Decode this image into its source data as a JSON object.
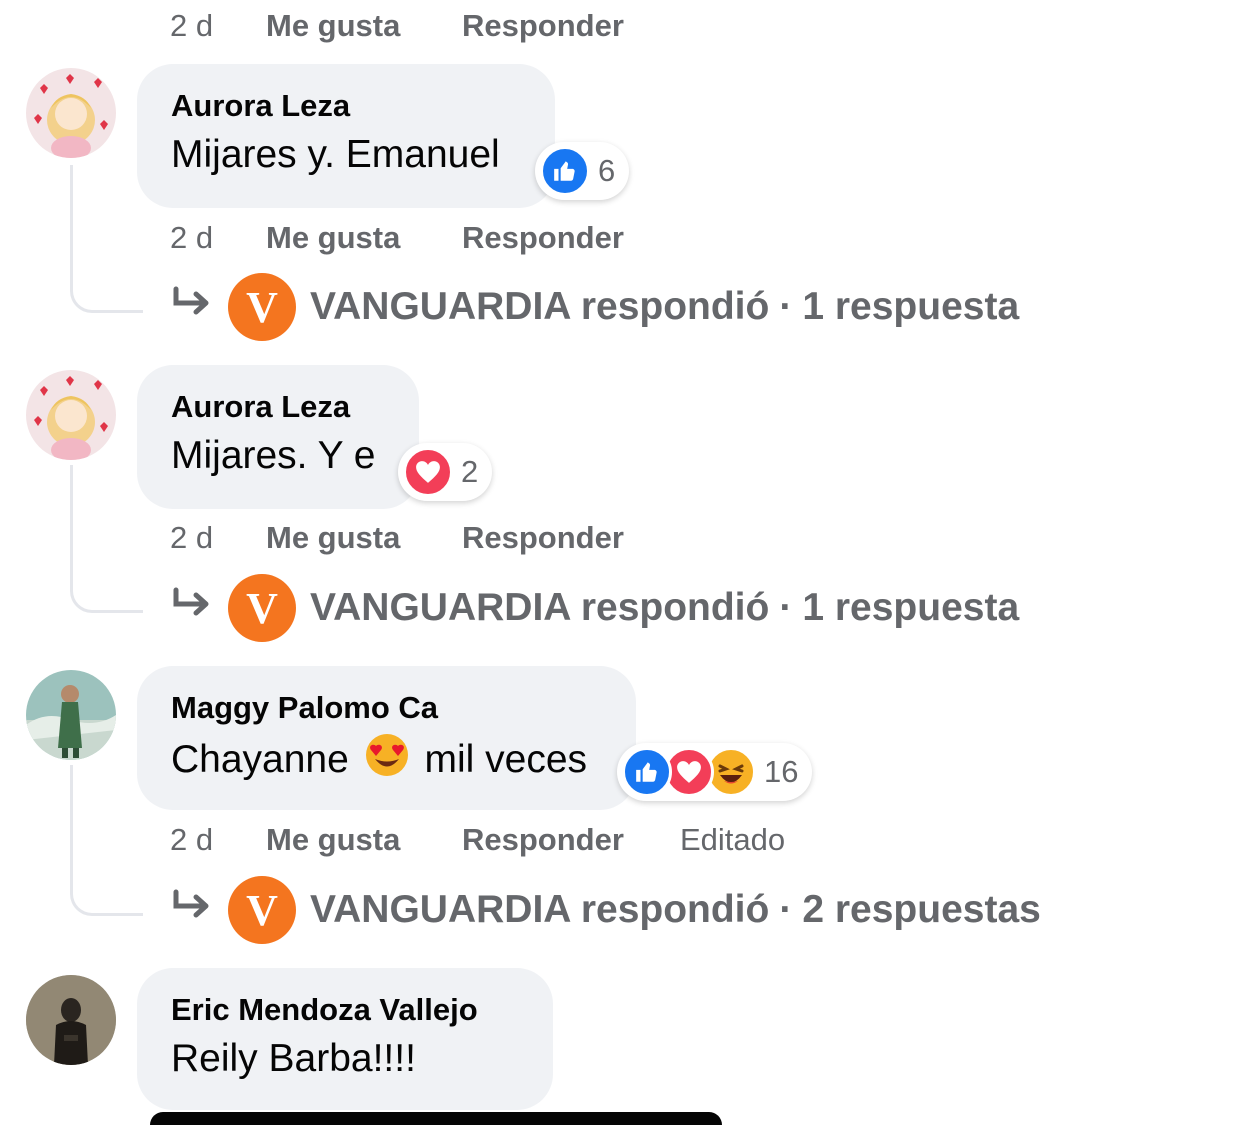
{
  "actions": {
    "like_label": "Me gusta",
    "reply_label": "Responder"
  },
  "top_meta": {
    "time": "2 d"
  },
  "comments": [
    {
      "author": "Aurora Leza",
      "text": "Mijares y. Emanuel",
      "reactions": [
        "like"
      ],
      "reaction_count": "6",
      "time": "2 d",
      "replies": {
        "replier": "VANGUARDIA respondió",
        "separator": "·",
        "count_text": "1 respuesta"
      }
    },
    {
      "author": "Aurora Leza",
      "text": "Mijares. Y e",
      "reactions": [
        "love"
      ],
      "reaction_count": "2",
      "time": "2 d",
      "replies": {
        "replier": "VANGUARDIA respondió",
        "separator": "·",
        "count_text": "1 respuesta"
      }
    },
    {
      "author": "Maggy Palomo Ca",
      "text_before": "Chayanne",
      "emoji": "😍",
      "text_after": "mil veces",
      "reactions": [
        "like",
        "love",
        "haha"
      ],
      "reaction_count": "16",
      "time": "2 d",
      "edited": "Editado",
      "replies": {
        "replier": "VANGUARDIA respondió",
        "separator": "·",
        "count_text": "2 respuestas"
      }
    },
    {
      "author": "Eric Mendoza Vallejo",
      "text": "Reily Barba!!!!"
    }
  ],
  "page_logo_letter": "V",
  "colors": {
    "like_blue": "#1877f2",
    "love_red": "#f33e58",
    "haha_yellow": "#f7b125",
    "vanguardia_orange": "#f4751f",
    "bubble_bg": "#f0f2f5",
    "meta_gray": "#65676b"
  },
  "icons": {
    "reply_arrow": "reply-arrow-icon",
    "like": "thumbs-up-icon",
    "love": "heart-icon",
    "haha": "laughing-face-icon"
  }
}
